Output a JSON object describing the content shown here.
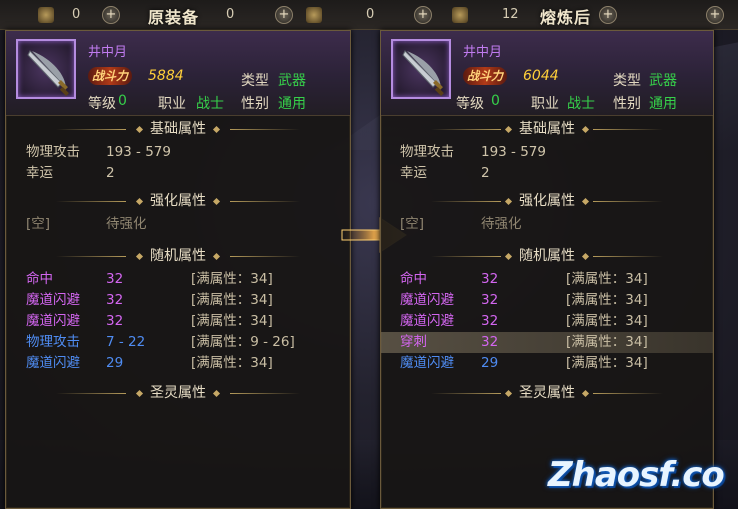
{
  "topbar": {
    "left_count_1": "0",
    "left_title": "原装备",
    "left_count_2": "0",
    "right_count_1": "0",
    "right_count_2": "12",
    "right_title": "熔炼后",
    "plus": "+"
  },
  "before": {
    "item_name": "井中月",
    "power_label": "战斗力",
    "power_value": "5884",
    "type_label": "类型",
    "type_value": "武器",
    "level_label": "等级",
    "level_value": "0",
    "job_label": "职业",
    "job_value": "战士",
    "gender_label": "性别",
    "gender_value": "通用",
    "sections": {
      "base": "基础属性",
      "enhance": "强化属性",
      "random": "随机属性",
      "holy": "圣灵属性"
    },
    "base_attrs": [
      {
        "name": "物理攻击",
        "value": "193 - 579"
      },
      {
        "name": "幸运",
        "value": "2"
      }
    ],
    "enhance": {
      "slot": "[空]",
      "status": "待强化"
    },
    "random_attrs": [
      {
        "name": "命中",
        "value": "32",
        "max": "[满属性：34]",
        "color": "pink"
      },
      {
        "name": "魔道闪避",
        "value": "32",
        "max": "[满属性：34]",
        "color": "pink"
      },
      {
        "name": "魔道闪避",
        "value": "32",
        "max": "[满属性：34]",
        "color": "pink"
      },
      {
        "name": "物理攻击",
        "value": "7 - 22",
        "max": "[满属性：9 - 26]",
        "color": "blue"
      },
      {
        "name": "魔道闪避",
        "value": "29",
        "max": "[满属性：34]",
        "color": "blue"
      }
    ]
  },
  "after": {
    "item_name": "井中月",
    "power_label": "战斗力",
    "power_value": "6044",
    "type_label": "类型",
    "type_value": "武器",
    "level_label": "等级",
    "level_value": "0",
    "job_label": "职业",
    "job_value": "战士",
    "gender_label": "性别",
    "gender_value": "通用",
    "sections": {
      "base": "基础属性",
      "enhance": "强化属性",
      "random": "随机属性",
      "holy": "圣灵属性"
    },
    "base_attrs": [
      {
        "name": "物理攻击",
        "value": "193 - 579"
      },
      {
        "name": "幸运",
        "value": "2"
      }
    ],
    "enhance": {
      "slot": "[空]",
      "status": "待强化"
    },
    "random_attrs": [
      {
        "name": "命中",
        "value": "32",
        "max": "[满属性：34]",
        "color": "pink"
      },
      {
        "name": "魔道闪避",
        "value": "32",
        "max": "[满属性：34]",
        "color": "pink"
      },
      {
        "name": "魔道闪避",
        "value": "32",
        "max": "[满属性：34]",
        "color": "pink"
      },
      {
        "name": "穿刺",
        "value": "32",
        "max": "[满属性：34]",
        "color": "pink",
        "highlight": true
      },
      {
        "name": "魔道闪避",
        "value": "29",
        "max": "[满属性：34]",
        "color": "blue"
      }
    ]
  },
  "colors": {
    "pink": "#d366f0",
    "blue": "#4f8cf2",
    "green": "#36d04a",
    "power": "#ffcf3a",
    "name": "#c07bf0"
  },
  "icons": {
    "item": "sword-icon",
    "arrow": "right-arrow-icon"
  },
  "watermark": "Zhaosf.co"
}
